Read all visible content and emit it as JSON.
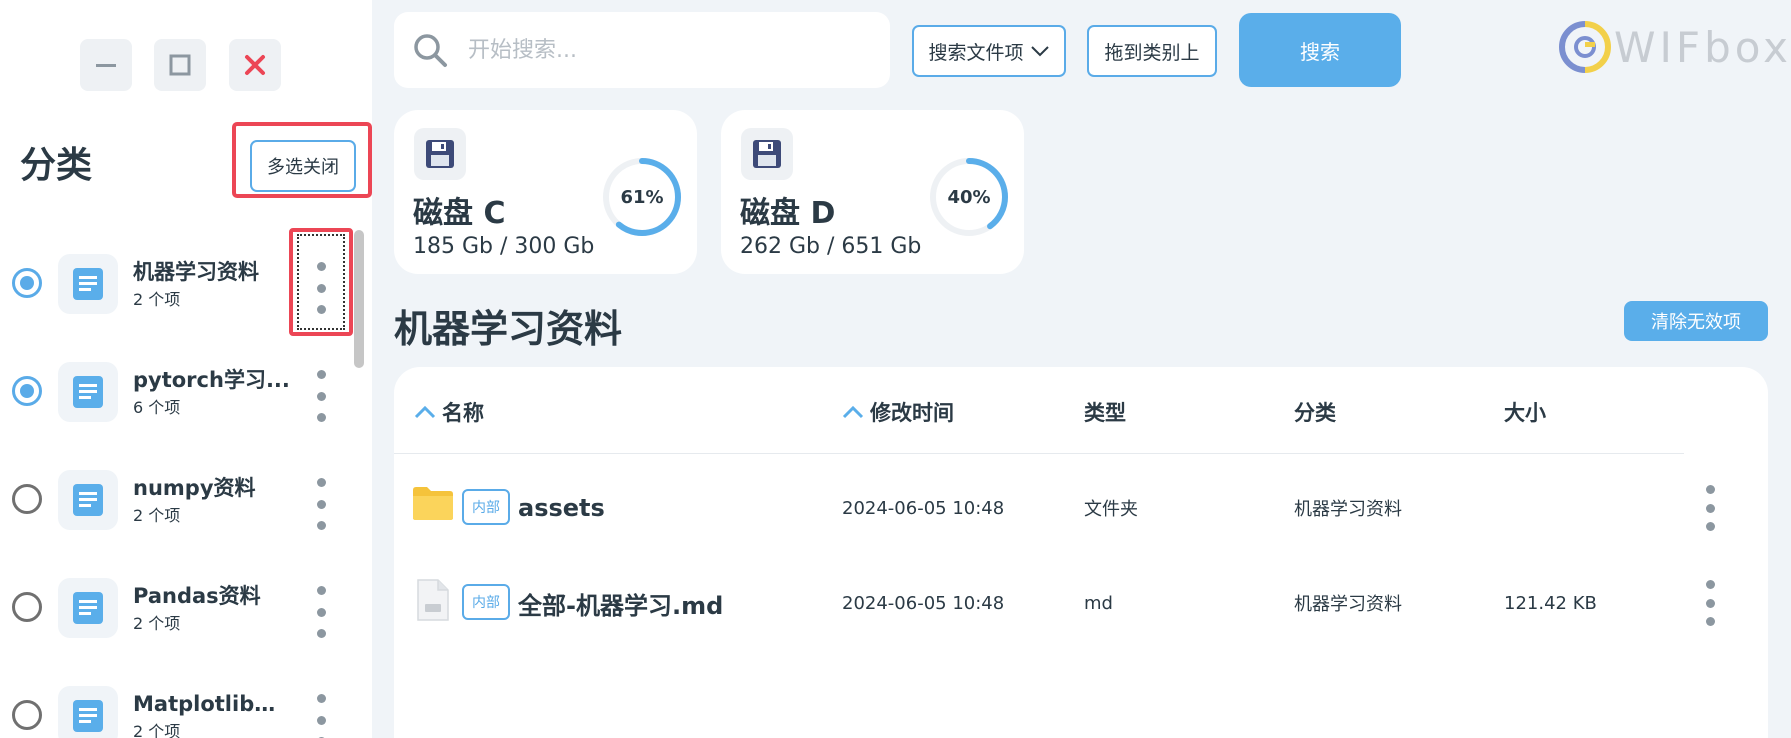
{
  "window_controls": {
    "minimize": "minimize-icon",
    "maximize": "maximize-icon",
    "close": "close-icon"
  },
  "sidebar": {
    "title": "分类",
    "multi_select_button": "多选关闭",
    "categories": [
      {
        "name": "机器学习资料",
        "count": "2 个项",
        "selected": true
      },
      {
        "name": "pytorch学习...",
        "count": "6 个项",
        "selected": true
      },
      {
        "name": "numpy资料",
        "count": "2 个项",
        "selected": false
      },
      {
        "name": "Pandas资料",
        "count": "2 个项",
        "selected": false
      },
      {
        "name": "Matplotlib资料",
        "count": "2 个项",
        "selected": false
      }
    ]
  },
  "search": {
    "placeholder": "开始搜索...",
    "scope_dropdown": "搜索文件项",
    "drag_button": "拖到类别上",
    "search_button": "搜索"
  },
  "logo": {
    "text": "WIFbox"
  },
  "disks": [
    {
      "name": "磁盘 C",
      "usage": "185 Gb / 300 Gb",
      "percent_label": "61%",
      "percent": 61
    },
    {
      "name": "磁盘 D",
      "usage": "262 Gb / 651 Gb",
      "percent_label": "40%",
      "percent": 40
    }
  ],
  "section": {
    "title": "机器学习资料",
    "clear_button": "清除无效项"
  },
  "table": {
    "headers": {
      "name": "名称",
      "modified": "修改时间",
      "type": "类型",
      "category": "分类",
      "size": "大小"
    },
    "rows": [
      {
        "icon": "folder-icon",
        "badge": "内部",
        "name": "assets",
        "modified": "2024-06-05 10:48",
        "type": "文件夹",
        "category": "机器学习资料",
        "size": ""
      },
      {
        "icon": "md-file-icon",
        "badge": "内部",
        "name": "全部-机器学习.md",
        "modified": "2024-06-05 10:48",
        "type": "md",
        "category": "机器学习资料",
        "size": "121.42 KB"
      }
    ]
  },
  "colors": {
    "accent": "#5aaeea",
    "highlight": "#ec4655",
    "text": "#2b3a45",
    "background": "#f0f4f8"
  }
}
